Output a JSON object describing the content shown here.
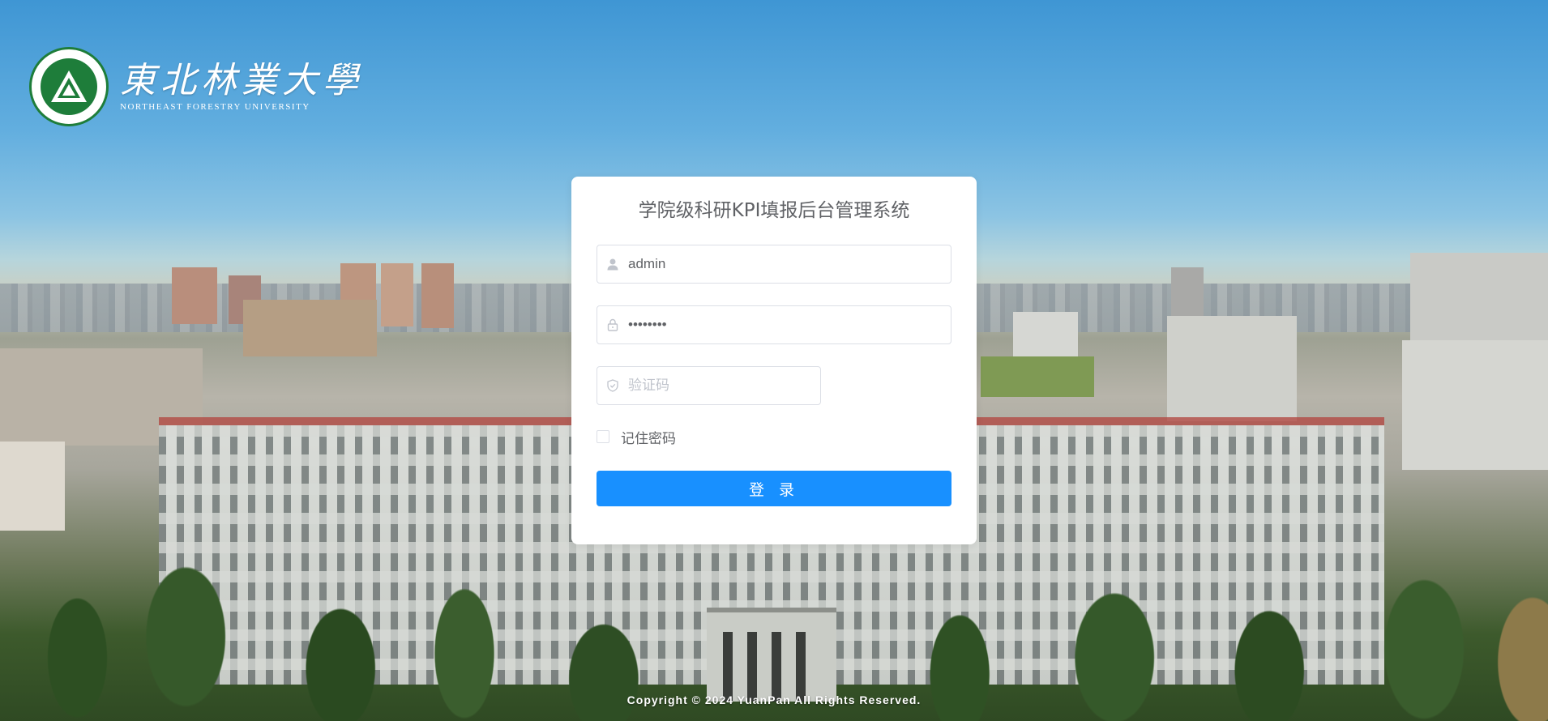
{
  "logo": {
    "cn": "東北林業大學",
    "en": "NORTHEAST FORESTRY UNIVERSITY",
    "emblem_icon": "nefu-emblem-icon",
    "accent_color": "#1e7d3a"
  },
  "login": {
    "title": "学院级科研KPI填报后台管理系统",
    "username": {
      "value": "admin",
      "icon": "user-icon"
    },
    "password": {
      "value": "12345678",
      "icon": "lock-icon"
    },
    "captcha": {
      "placeholder": "验证码",
      "icon": "shield-check-icon"
    },
    "remember_label": "记住密码",
    "remember_checked": false,
    "submit_label": "登 录",
    "button_color": "#1890ff"
  },
  "footer": {
    "copyright": "Copyright © 2024 YuanPan All Rights Reserved."
  }
}
